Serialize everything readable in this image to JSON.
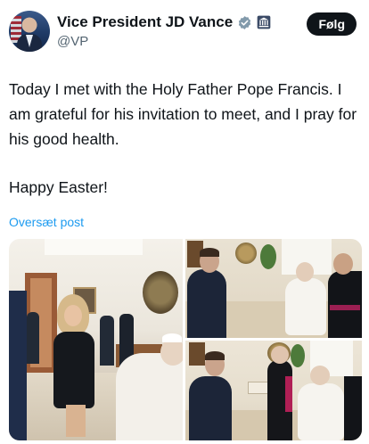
{
  "author": {
    "display_name": "Vice President JD Vance",
    "handle": "@VP"
  },
  "follow_button": {
    "label": "Følg"
  },
  "tweet": {
    "paragraph_1": "Today I met with the Holy Father Pope Francis. I am grateful for his invitation to meet, and I pray for his good health.",
    "paragraph_2": "Happy Easter!"
  },
  "translate": {
    "label": "Oversæt post"
  },
  "colors": {
    "text": "#0f1419",
    "secondary_text": "#536471",
    "link": "#1d9bf0",
    "follow_bg": "#0f1419",
    "verified_badge": "#829aab"
  },
  "icons": [
    "verified-badge-icon",
    "government-building-icon"
  ]
}
